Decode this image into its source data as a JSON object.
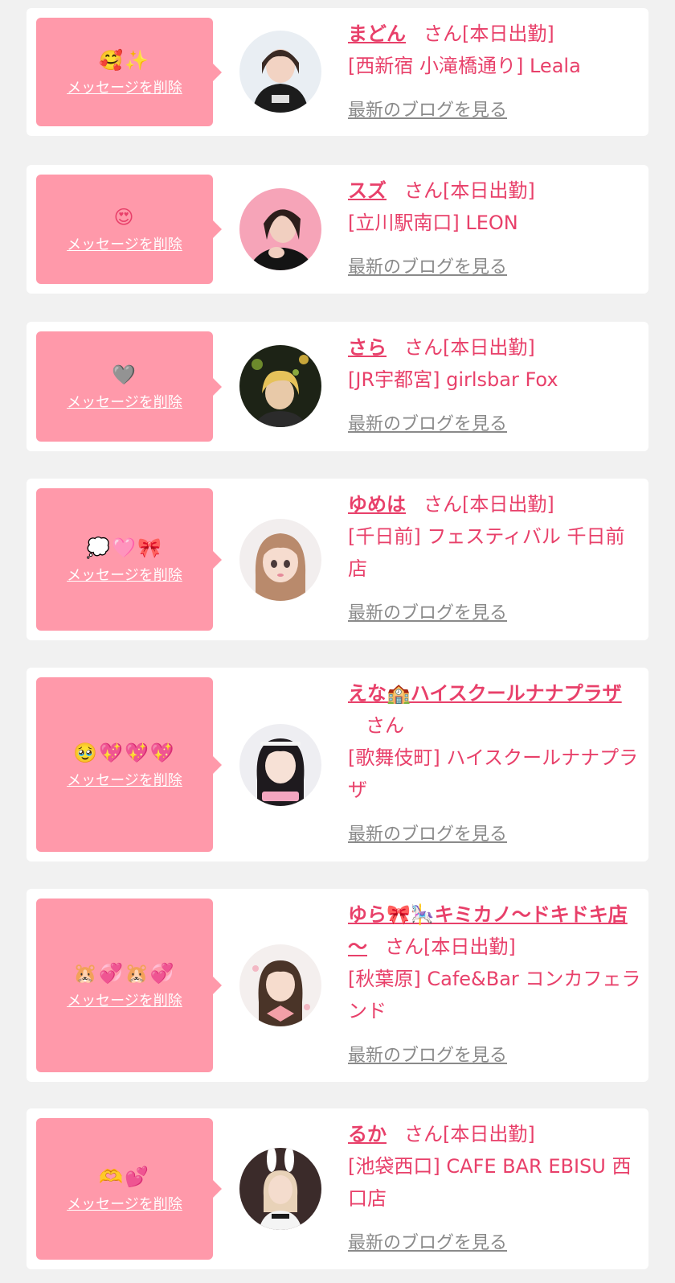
{
  "colors": {
    "page_bg": "#f1f1f1",
    "card_bg": "#ffffff",
    "bubble_bg": "#ff99aa",
    "accent": "#e8406a",
    "muted": "#8a8a8a"
  },
  "items": [
    {
      "message": "🥰✨",
      "delete_label": "メッセージを削除",
      "name": "まどん",
      "suffix": "さん[本日出勤]",
      "shop": "[西新宿 小滝橋通り] Leala",
      "blog_label": "最新のブログを見る",
      "avatar": "avatar-1"
    },
    {
      "message": "😍",
      "delete_label": "メッセージを削除",
      "name": "スズ",
      "suffix": "さん[本日出勤]",
      "shop": "[立川駅南口] LEON",
      "blog_label": "最新のブログを見る",
      "avatar": "avatar-2"
    },
    {
      "message": "🩶",
      "delete_label": "メッセージを削除",
      "name": "さら",
      "suffix": "さん[本日出勤]",
      "shop": "[JR宇都宮] girlsbar Fox",
      "blog_label": "最新のブログを見る",
      "avatar": "avatar-3"
    },
    {
      "message": "💭🩷🎀",
      "delete_label": "メッセージを削除",
      "name": "ゆめは",
      "suffix": "さん[本日出勤]",
      "shop": "[千日前] フェスティバル 千日前店",
      "blog_label": "最新のブログを見る",
      "avatar": "avatar-4"
    },
    {
      "message": "🥹💖💖💖",
      "delete_label": "メッセージを削除",
      "name": "えな🏫ハイスクールナナプラザ",
      "suffix": "さん",
      "shop": "[歌舞伎町] ハイスクールナナプラザ",
      "blog_label": "最新のブログを見る",
      "avatar": "avatar-5"
    },
    {
      "message": "🐹💞🐹💞",
      "delete_label": "メッセージを削除",
      "name": "ゆら🎀🎠キミカノ～ドキドキ店～",
      "suffix": "さん[本日出勤]",
      "shop": "[秋葉原] Cafe&Bar コンカフェランド",
      "blog_label": "最新のブログを見る",
      "avatar": "avatar-6"
    },
    {
      "message": "🫶💕",
      "delete_label": "メッセージを削除",
      "name": "るか",
      "suffix": "さん[本日出勤]",
      "shop": "[池袋西口] CAFE BAR EBISU 西口店",
      "blog_label": "最新のブログを見る",
      "avatar": "avatar-7"
    }
  ]
}
